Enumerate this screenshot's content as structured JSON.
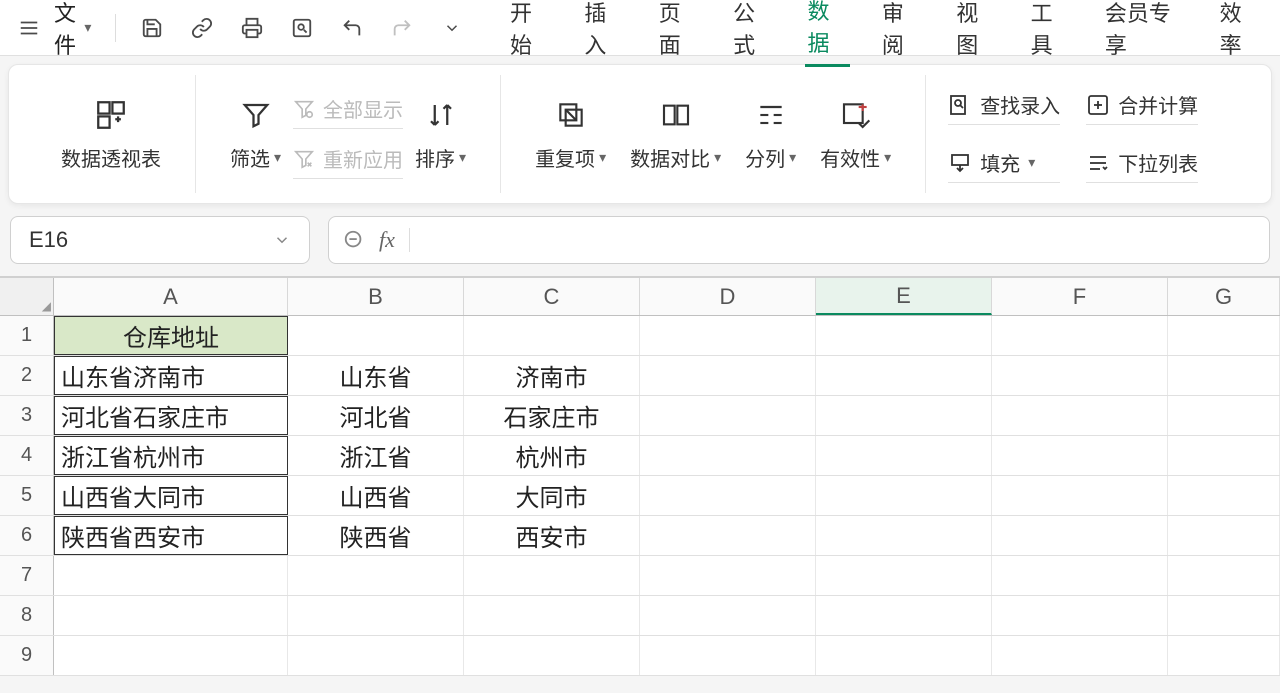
{
  "menubar": {
    "file_label": "文件",
    "tabs": [
      "开始",
      "插入",
      "页面",
      "公式",
      "数据",
      "审阅",
      "视图",
      "工具",
      "会员专享",
      "效率"
    ],
    "active_index": 4
  },
  "ribbon": {
    "pivot_label": "数据透视表",
    "filter_label": "筛选",
    "show_all_label": "全部显示",
    "reapply_label": "重新应用",
    "sort_label": "排序",
    "duplicate_label": "重复项",
    "compare_label": "数据对比",
    "split_label": "分列",
    "validity_label": "有效性",
    "lookup_label": "查找录入",
    "fill_label": "填充",
    "consolidate_label": "合并计算",
    "dropdown_list_label": "下拉列表"
  },
  "namebox": {
    "value": "E16"
  },
  "formula": {
    "fx_label": "fx",
    "value": ""
  },
  "columns": [
    "A",
    "B",
    "C",
    "D",
    "E",
    "F",
    "G"
  ],
  "selected_col": "E",
  "rows": [
    {
      "num": 1,
      "A": "仓库地址",
      "B": "",
      "C": "",
      "header": true
    },
    {
      "num": 2,
      "A": "山东省济南市",
      "B": "山东省",
      "C": "济南市"
    },
    {
      "num": 3,
      "A": "河北省石家庄市",
      "B": "河北省",
      "C": "石家庄市"
    },
    {
      "num": 4,
      "A": "浙江省杭州市",
      "B": "浙江省",
      "C": "杭州市"
    },
    {
      "num": 5,
      "A": "山西省大同市",
      "B": "山西省",
      "C": "大同市"
    },
    {
      "num": 6,
      "A": "陕西省西安市",
      "B": "陕西省",
      "C": "西安市"
    },
    {
      "num": 7,
      "A": "",
      "B": "",
      "C": ""
    },
    {
      "num": 8,
      "A": "",
      "B": "",
      "C": ""
    },
    {
      "num": 9,
      "A": "",
      "B": "",
      "C": ""
    }
  ]
}
